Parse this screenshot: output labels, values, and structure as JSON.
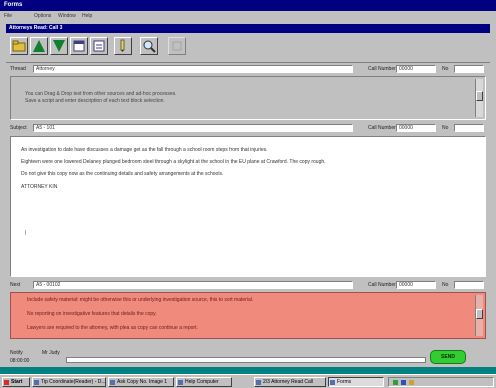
{
  "outer_window": {
    "title": "Forms",
    "menu": [
      "File",
      "Options",
      "Window",
      "Help"
    ]
  },
  "inner_window": {
    "title": "Attorneys Read: Call 3"
  },
  "toolbar": {
    "icons": [
      "folder-icon",
      "up-arrow-icon",
      "down-arrow-icon",
      "document-icon",
      "document-icon",
      "pen-icon",
      "magnifier-icon",
      "disabled-icon"
    ]
  },
  "fields": {
    "row1": {
      "label": "Thread",
      "value": "Attorney",
      "case_label": "Call Number",
      "case_value": "00000",
      "no_label": "No"
    },
    "row2": {
      "label": "Subject",
      "value": "A5 - 101",
      "case_label": "Call Number",
      "case_value": "00000",
      "no_label": "No"
    },
    "row3": {
      "label": "Next",
      "value": "A5 - 00102",
      "case_label": "Call Number",
      "case_value": "00000",
      "no_label": "No"
    }
  },
  "notes": {
    "line1": "You can Drag & Drop text from other sources and ad-hoc processes.",
    "line2": "Save a script and enter description of each text block selection."
  },
  "main_text": {
    "p1": "An investigation to date have discusses a damage get as the fall through a school room steps from that injuries.",
    "p2": "Eighteen were one lowered Delaney plunged bedroom steel through a skylight at the school in the EU plane at Crawford. The copy rough.",
    "p3": "Do not give this copy now as the continuing details and safety arrangements at the schools.",
    "p4": "ATTORNEY KIN",
    "cursor": "|"
  },
  "alerts": {
    "line1": "Include safety material: might be otherwise this or underlying investigation source, this to sort material.",
    "line2": "No reporting on investigative features that details the copy.",
    "line3": "Lawyers are required to the attorney, with plea as copy can continue a report."
  },
  "status": {
    "label1": "Notify",
    "label2": "Mr Judy",
    "go_label": "SEND",
    "time": "08:00:00"
  },
  "taskbar": {
    "start": "Start",
    "buttons": [
      "Tip Coordinate(Reader) - D...",
      "Ask Copy No. Image 1",
      "Help Computer",
      "2/3 Attorney Read Call",
      "Forms"
    ],
    "active_index": 4
  },
  "colors": {
    "titlebar": "#000080",
    "alert_background": "#f08a7c",
    "go_button": "#33cc33"
  }
}
